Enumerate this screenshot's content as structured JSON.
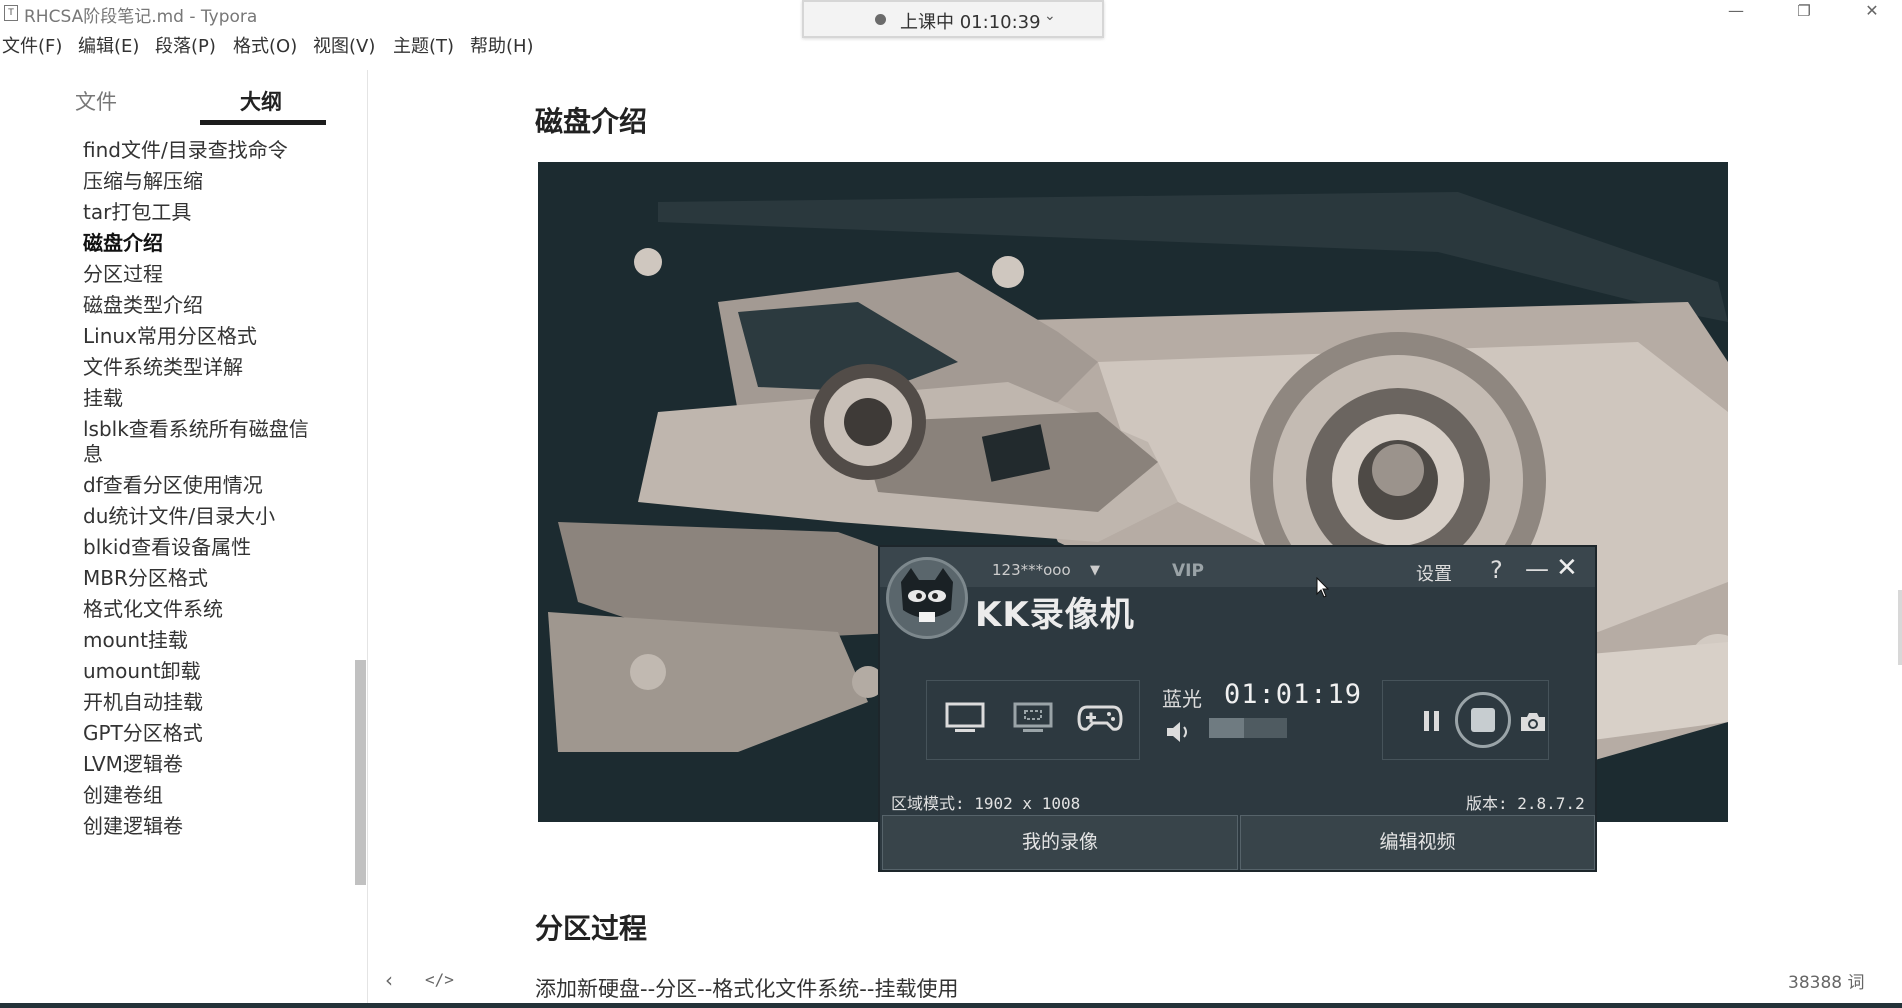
{
  "window": {
    "title": "RHCSA阶段笔记.md - Typora",
    "app_icon": "T",
    "minimize_icon": "—",
    "maximize_icon": "❐",
    "close_icon": "✕"
  },
  "live_badge": {
    "text": "上课中 01:10:39",
    "chevron": "⌄"
  },
  "menu": [
    "文件(F)",
    "编辑(E)",
    "段落(P)",
    "格式(O)",
    "视图(V)",
    "主题(T)",
    "帮助(H)"
  ],
  "sidebar": {
    "tabs": {
      "files": "文件",
      "outline": "大纲"
    },
    "outline_items": [
      "find文件/目录查找命令",
      "压缩与解压缩",
      "tar打包工具",
      "磁盘介绍",
      "分区过程",
      "磁盘类型介绍",
      "Linux常用分区格式",
      "文件系统类型详解",
      "挂载",
      "lsblk查看系统所有磁盘信息",
      "df查看分区使用情况",
      "du统计文件/目录大小",
      "blkid查看设备属性",
      "MBR分区格式",
      "格式化文件系统",
      "mount挂载",
      "umount卸载",
      "开机自动挂载",
      "GPT分区格式",
      "LVM逻辑卷",
      "创建卷组",
      "创建逻辑卷"
    ],
    "active_item": "磁盘介绍"
  },
  "editor": {
    "heading1": "磁盘介绍",
    "heading2": "分区过程",
    "paragraph": "添加新硬盘--分区--格式化文件系统--挂载使用",
    "image_alt": "hard-disk-photo"
  },
  "status": {
    "word_count": "38388 词",
    "nav_back_icon": "‹",
    "source_code_icon": "</>"
  },
  "recorder": {
    "user": "123***ooo",
    "dropdown_icon": "▼",
    "vip": "VIP",
    "settings": "设置",
    "help": "?",
    "minimize": "—",
    "close": "✕",
    "logo": "KK录像机",
    "quality": "蓝光",
    "timer": "01:01:19",
    "volume_level": 0.45,
    "region_mode": "区域模式: 1902 x 1008",
    "version": "版本: 2.8.7.2",
    "my_recordings": "我的录像",
    "edit_video": "编辑视频"
  },
  "colors": {
    "recorder_bg": "#2d3940",
    "outline_underline": "#1c1c1c",
    "image_dark": "#1c2b30"
  }
}
